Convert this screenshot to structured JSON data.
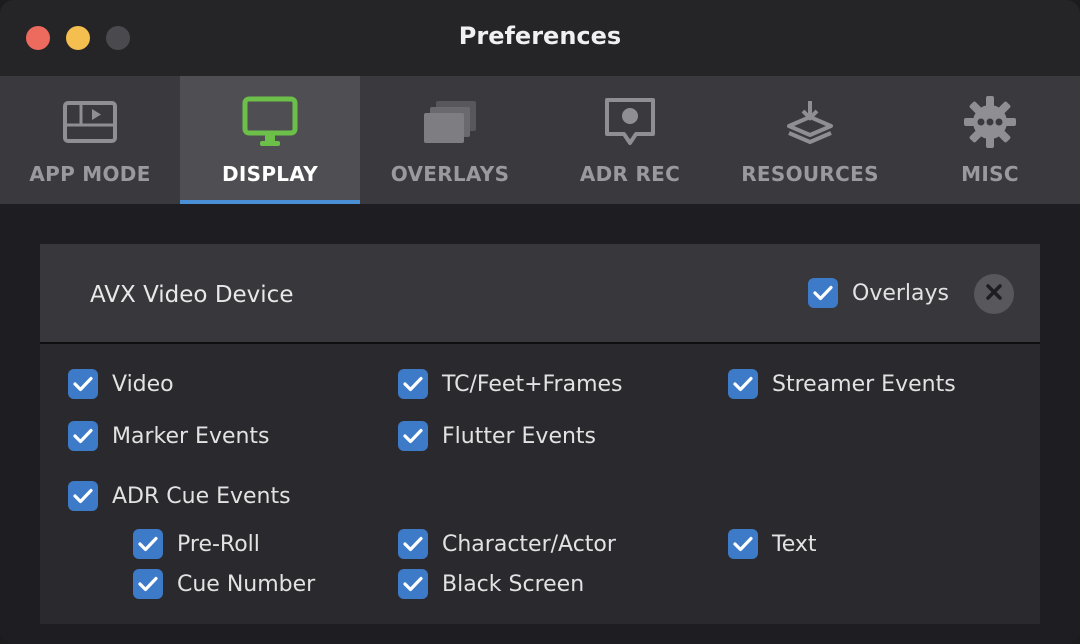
{
  "window": {
    "title": "Preferences"
  },
  "tabs": [
    {
      "label": "APP MODE",
      "icon": "app-mode-icon",
      "active": false
    },
    {
      "label": "DISPLAY",
      "icon": "display-monitor-icon",
      "active": true
    },
    {
      "label": "OVERLAYS",
      "icon": "overlays-stack-icon",
      "active": false
    },
    {
      "label": "ADR REC",
      "icon": "adr-rec-icon",
      "active": false
    },
    {
      "label": "RESOURCES",
      "icon": "resources-download-icon",
      "active": false
    },
    {
      "label": "MISC",
      "icon": "gear-icon",
      "active": false
    }
  ],
  "colors": {
    "accent": "#4a8fd6",
    "checkbox": "#3d7bc9",
    "display_icon": "#6cc04a"
  },
  "device": {
    "name": "AVX Video Device",
    "overlays_label": "Overlays",
    "overlays_checked": true
  },
  "options": {
    "video": {
      "label": "Video",
      "checked": true
    },
    "tc_feet_frames": {
      "label": "TC/Feet+Frames",
      "checked": true
    },
    "streamer_events": {
      "label": "Streamer Events",
      "checked": true
    },
    "marker_events": {
      "label": "Marker Events",
      "checked": true
    },
    "flutter_events": {
      "label": "Flutter Events",
      "checked": true
    },
    "adr_cue_events": {
      "label": "ADR Cue Events",
      "checked": true
    },
    "pre_roll": {
      "label": "Pre-Roll",
      "checked": true
    },
    "character_actor": {
      "label": "Character/Actor",
      "checked": true
    },
    "text": {
      "label": "Text",
      "checked": true
    },
    "cue_number": {
      "label": "Cue Number",
      "checked": true
    },
    "black_screen": {
      "label": "Black Screen",
      "checked": true
    }
  }
}
